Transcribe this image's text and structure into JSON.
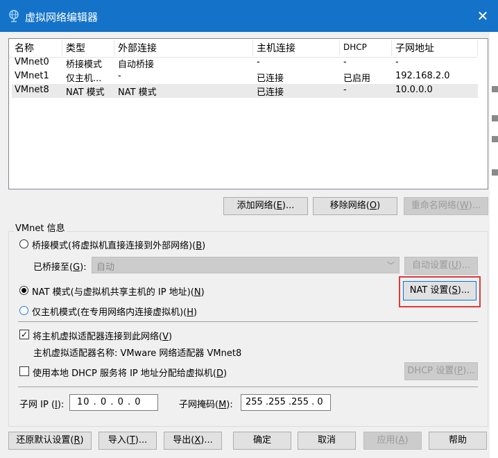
{
  "window": {
    "title": "虚拟网络编辑器",
    "close_label": "✕"
  },
  "network_table": {
    "columns": [
      "名称",
      "类型",
      "外部连接",
      "主机连接",
      "DHCP",
      "子网地址"
    ],
    "rows": [
      {
        "name": "VMnet0",
        "type": "桥接模式",
        "external": "自动桥接",
        "host": "-",
        "dhcp": "-",
        "subnet": "-"
      },
      {
        "name": "VMnet1",
        "type": "仅主机...",
        "external": "-",
        "host": "已连接",
        "dhcp": "已启用",
        "subnet": "192.168.2.0"
      },
      {
        "name": "VMnet8",
        "type": "NAT 模式",
        "external": "NAT 模式",
        "host": "已连接",
        "dhcp": "-",
        "subnet": "10.0.0.0"
      }
    ],
    "selected_row": 2
  },
  "table_buttons": {
    "add": {
      "text": "添加网络(",
      "hk": "E",
      "tail": ")..."
    },
    "remove": {
      "text": "移除网络(",
      "hk": "O",
      "tail": ")"
    },
    "rename": {
      "text": "重命名网络(",
      "hk": "W",
      "tail": ")..."
    }
  },
  "vmnet_info": {
    "group_label": "VMnet 信息",
    "bridged": {
      "text": "桥接模式(将虚拟机直接连接到外部网络)(",
      "hk": "B",
      "tail": ")"
    },
    "bridged_to": {
      "text": "已桥接至(",
      "hk": "G",
      "tail": "):",
      "value": "自动"
    },
    "auto_settings": {
      "text": "自动设置(",
      "hk": "U",
      "tail": ")..."
    },
    "nat": {
      "text": "NAT 模式(与虚拟机共享主机的 IP 地址)(",
      "hk": "N",
      "tail": ")"
    },
    "nat_settings": {
      "text": "NAT 设置(",
      "hk": "S",
      "tail": ")..."
    },
    "host_only": {
      "text": "仅主机模式(在专用网络内连接虚拟机)(",
      "hk": "H",
      "tail": ")"
    },
    "connect_adapter": {
      "text": "将主机虚拟适配器连接到此网络(",
      "hk": "V",
      "tail": ")",
      "checked": true
    },
    "adapter_name": "主机虚拟适配器名称: VMware 网络适配器 VMnet8",
    "use_dhcp": {
      "text": "使用本地 DHCP 服务将 IP 地址分配给虚拟机(",
      "hk": "D",
      "tail": ")",
      "checked": false
    },
    "dhcp_settings": {
      "text": "DHCP 设置(",
      "hk": "P",
      "tail": ")..."
    },
    "subnet_ip": {
      "text": "子网 IP (",
      "hk": "I",
      "tail": "):",
      "value": "10 . 0 . 0 . 0"
    },
    "subnet_mask": {
      "text": "子网掩码(",
      "hk": "M",
      "tail": "):",
      "value": "255 .255 .255 . 0"
    },
    "selected_mode": "nat"
  },
  "footer_buttons": {
    "restore": {
      "text": "还原默认设置(",
      "hk": "R",
      "tail": ")"
    },
    "import": {
      "text": "导入(",
      "hk": "T",
      "tail": ")..."
    },
    "export": {
      "text": "导出(",
      "hk": "X",
      "tail": ")..."
    },
    "ok": {
      "text": "确定"
    },
    "cancel": {
      "text": "取消"
    },
    "apply": {
      "text": "应用(",
      "hk": "A",
      "tail": ")"
    },
    "help": {
      "text": "帮助"
    }
  },
  "colors": {
    "titlebar": "#1473c8",
    "dialog_bg": "#f0f0f0",
    "highlight_box": "#e0383a"
  }
}
